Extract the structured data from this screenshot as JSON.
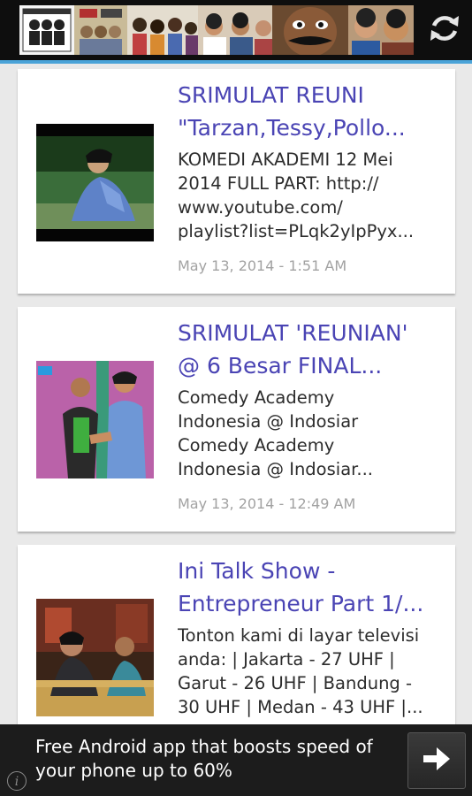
{
  "header": {
    "banner_icon": "srimulat-cast-banner",
    "refresh_icon": "refresh-icon"
  },
  "items": [
    {
      "title": "SRIMULAT REUNI \"Tarzan,Tessy,Pollo...",
      "desc": [
        "KOMEDI AKADEMI 12 Mei",
        "2014 FULL PART: http://",
        "www.youtube.com/",
        "playlist?list=PLqk2yIpPyx..."
      ],
      "date": "May 13, 2014 - 1:51 AM"
    },
    {
      "title": "SRIMULAT 'REUNIAN' @ 6 Besar FINAL...",
      "desc": [
        "Comedy Academy",
        "Indonesia @ Indosiar",
        "Comedy Academy",
        "Indonesia @ Indosiar..."
      ],
      "date": "May 13, 2014 - 12:49 AM"
    },
    {
      "title": "Ini Talk Show - Entrepreneur Part 1/...",
      "desc": [
        "Tonton kami di layar televisi",
        "anda: | Jakarta - 27 UHF |",
        "Garut - 26 UHF | Bandung -",
        "30 UHF | Medan - 43 UHF |..."
      ],
      "date": ""
    }
  ],
  "titles_split": [
    [
      "SRIMULAT REUNI",
      "\"Tarzan,Tessy,Pollo..."
    ],
    [
      "SRIMULAT 'REUNIAN'",
      "@ 6 Besar FINAL..."
    ],
    [
      "Ini Talk Show -",
      "Entrepreneur Part 1/..."
    ]
  ],
  "ad": {
    "line1": "Free Android app that boosts speed of",
    "line2": "your phone up to 60%",
    "arrow_icon": "arrow-right-icon",
    "info_icon": "info-icon",
    "info_glyph": "i"
  }
}
